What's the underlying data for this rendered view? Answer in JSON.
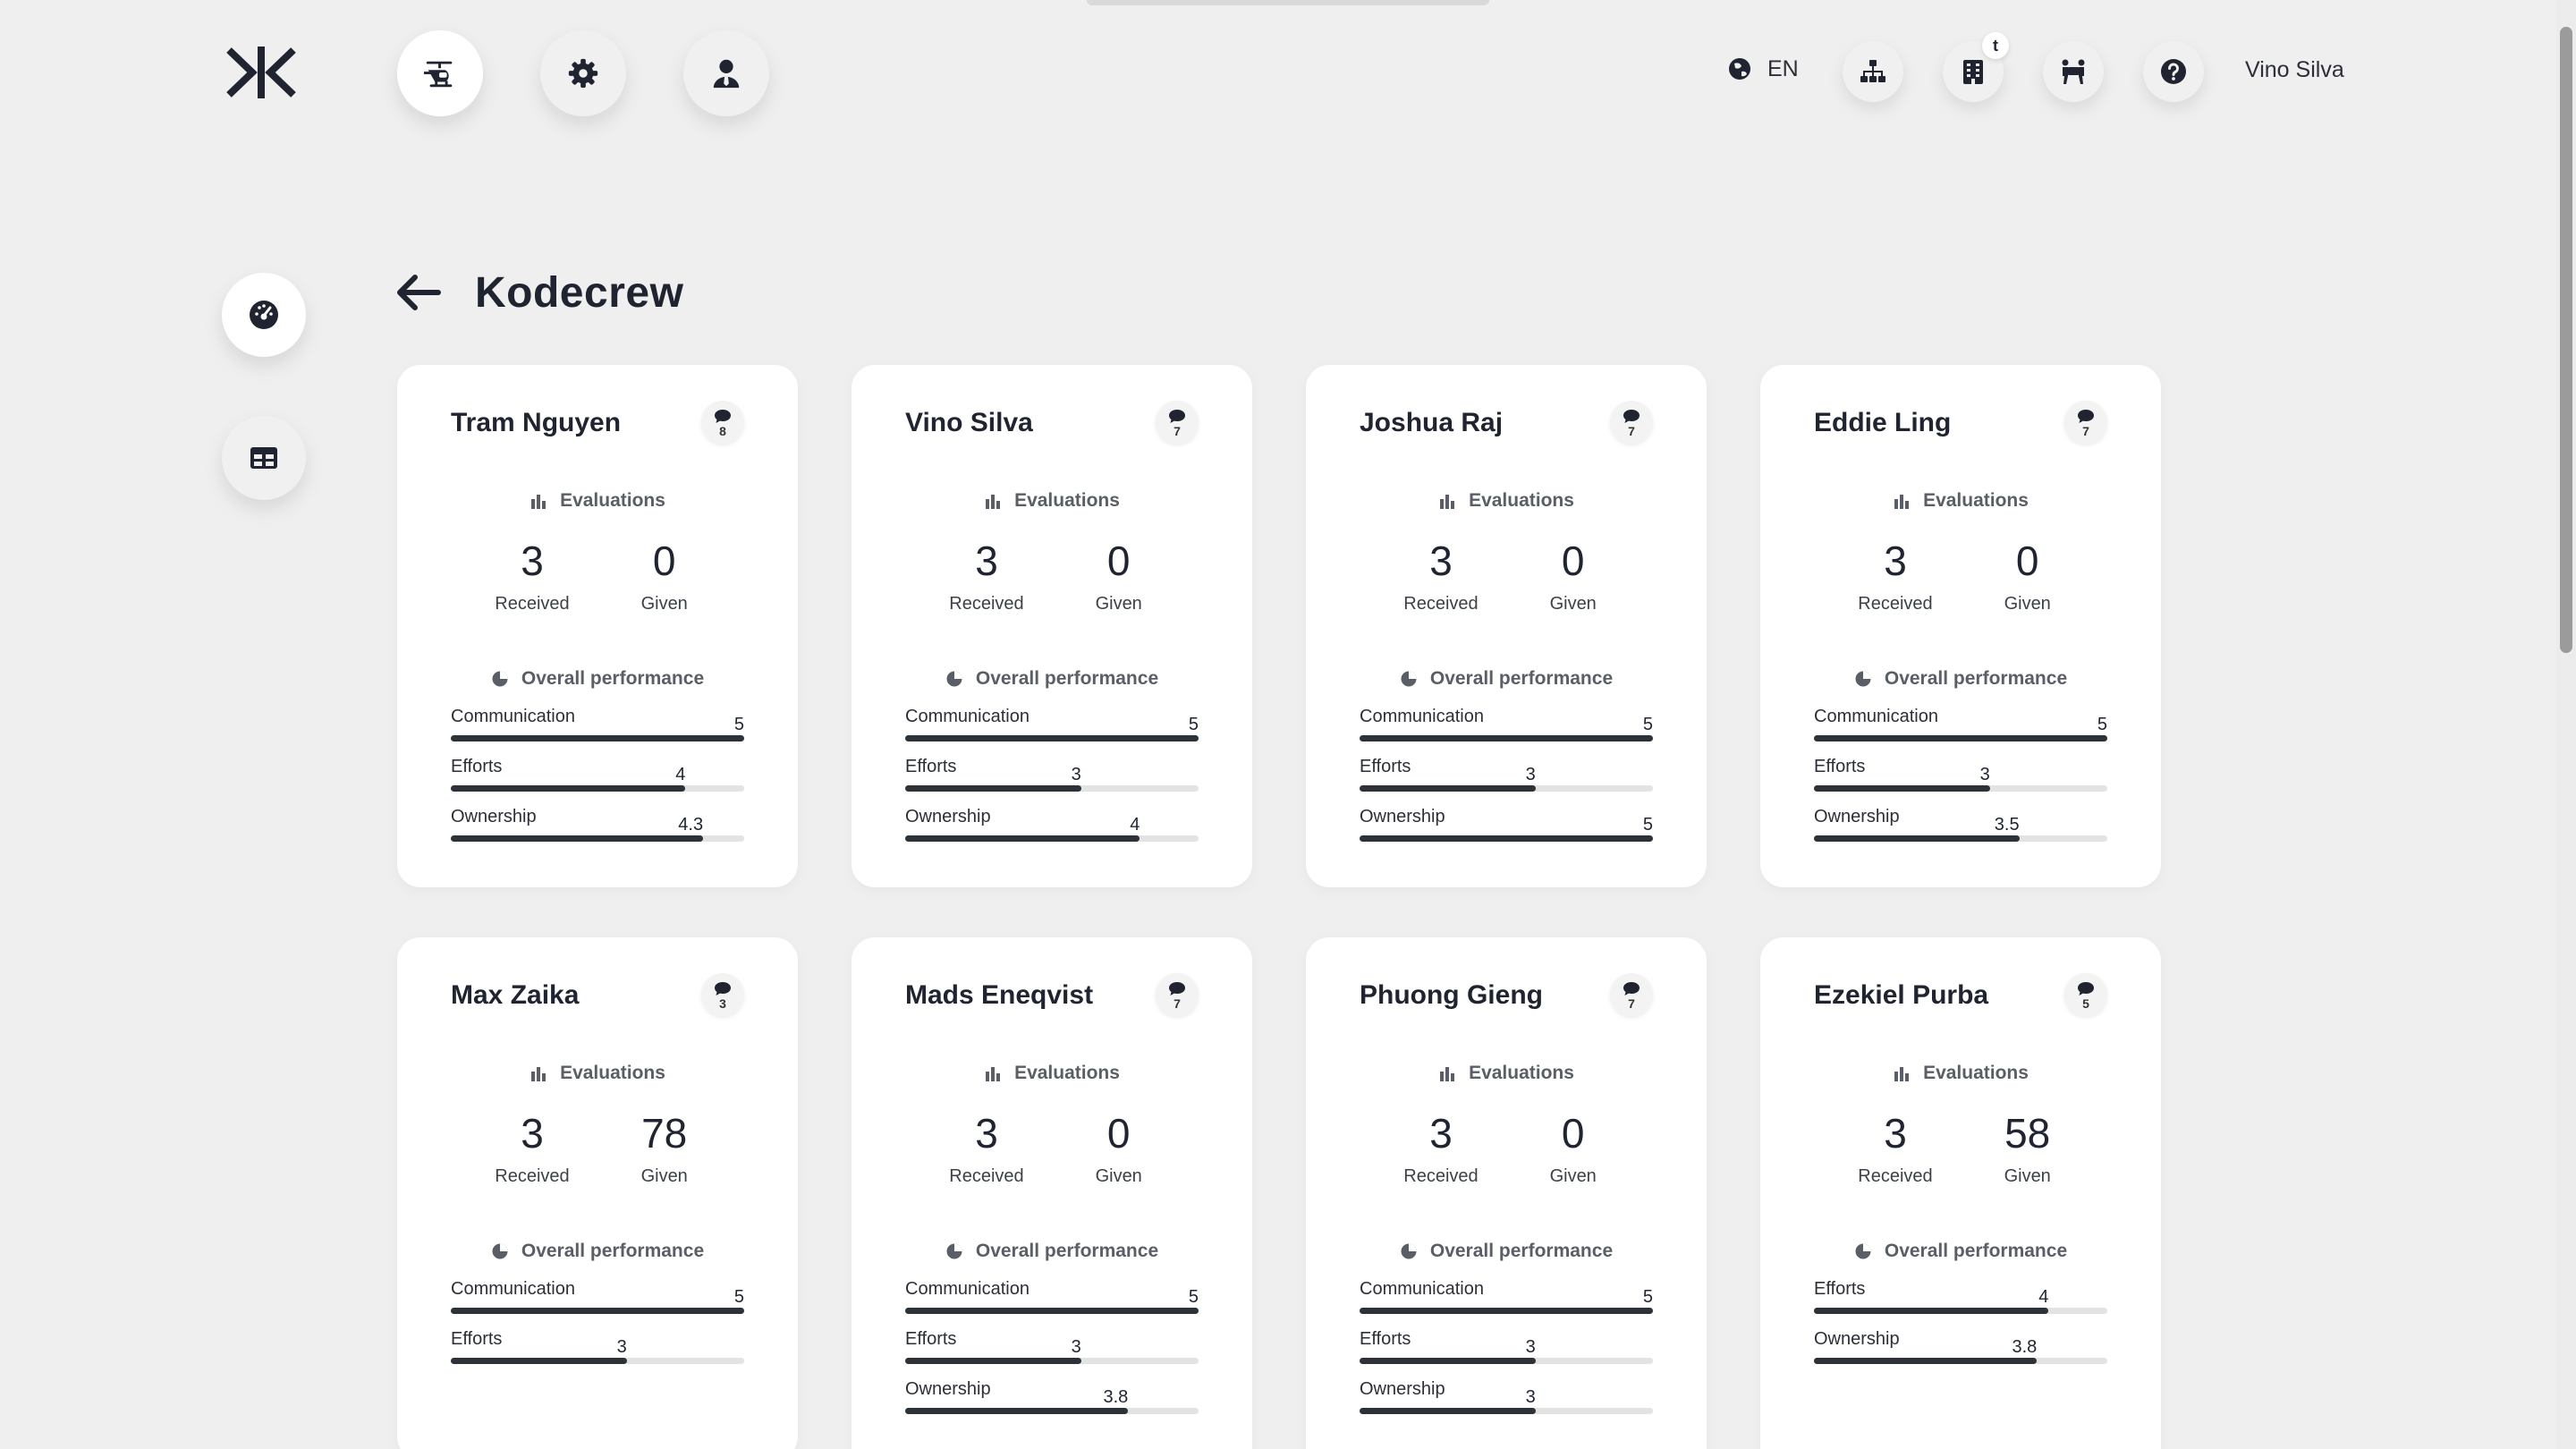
{
  "header": {
    "language": "EN",
    "user_name": "Vino Silva",
    "notification_badge": "t",
    "nav": [
      "helicopter-icon",
      "gear-icon",
      "user-tie-icon"
    ],
    "tools": [
      "sitemap-icon",
      "building-icon",
      "people-carry-icon",
      "question-icon"
    ]
  },
  "sidebar": [
    "dashboard-icon",
    "table-icon"
  ],
  "page": {
    "title": "Kodecrew"
  },
  "labels": {
    "evaluations": "Evaluations",
    "received": "Received",
    "given": "Given",
    "overall": "Overall performance"
  },
  "members": [
    {
      "name": "Tram Nguyen",
      "badge": "8",
      "received": "3",
      "given": "0",
      "metrics": [
        {
          "label": "Communication",
          "value": "5",
          "fraction": 1.0
        },
        {
          "label": "Efforts",
          "value": "4",
          "fraction": 0.8
        },
        {
          "label": "Ownership",
          "value": "4.3",
          "fraction": 0.86
        }
      ]
    },
    {
      "name": "Vino Silva",
      "badge": "7",
      "received": "3",
      "given": "0",
      "metrics": [
        {
          "label": "Communication",
          "value": "5",
          "fraction": 1.0
        },
        {
          "label": "Efforts",
          "value": "3",
          "fraction": 0.6
        },
        {
          "label": "Ownership",
          "value": "4",
          "fraction": 0.8
        }
      ]
    },
    {
      "name": "Joshua Raj",
      "badge": "7",
      "received": "3",
      "given": "0",
      "metrics": [
        {
          "label": "Communication",
          "value": "5",
          "fraction": 1.0
        },
        {
          "label": "Efforts",
          "value": "3",
          "fraction": 0.6
        },
        {
          "label": "Ownership",
          "value": "5",
          "fraction": 1.0
        }
      ]
    },
    {
      "name": "Eddie Ling",
      "badge": "7",
      "received": "3",
      "given": "0",
      "metrics": [
        {
          "label": "Communication",
          "value": "5",
          "fraction": 1.0
        },
        {
          "label": "Efforts",
          "value": "3",
          "fraction": 0.6
        },
        {
          "label": "Ownership",
          "value": "3.5",
          "fraction": 0.7
        }
      ]
    },
    {
      "name": "Max Zaika",
      "badge": "3",
      "received": "3",
      "given": "78",
      "metrics": [
        {
          "label": "Communication",
          "value": "5",
          "fraction": 1.0
        },
        {
          "label": "Efforts",
          "value": "3",
          "fraction": 0.6
        }
      ]
    },
    {
      "name": "Mads Eneqvist",
      "badge": "7",
      "received": "3",
      "given": "0",
      "metrics": [
        {
          "label": "Communication",
          "value": "5",
          "fraction": 1.0
        },
        {
          "label": "Efforts",
          "value": "3",
          "fraction": 0.6
        },
        {
          "label": "Ownership",
          "value": "3.8",
          "fraction": 0.76
        }
      ]
    },
    {
      "name": "Phuong Gieng",
      "badge": "7",
      "received": "3",
      "given": "0",
      "metrics": [
        {
          "label": "Communication",
          "value": "5",
          "fraction": 1.0
        },
        {
          "label": "Efforts",
          "value": "3",
          "fraction": 0.6
        },
        {
          "label": "Ownership",
          "value": "3",
          "fraction": 0.6
        }
      ]
    },
    {
      "name": "Ezekiel Purba",
      "badge": "5",
      "received": "3",
      "given": "58",
      "metrics": [
        {
          "label": "Efforts",
          "value": "4",
          "fraction": 0.8
        },
        {
          "label": "Ownership",
          "value": "3.8",
          "fraction": 0.76
        }
      ]
    }
  ]
}
